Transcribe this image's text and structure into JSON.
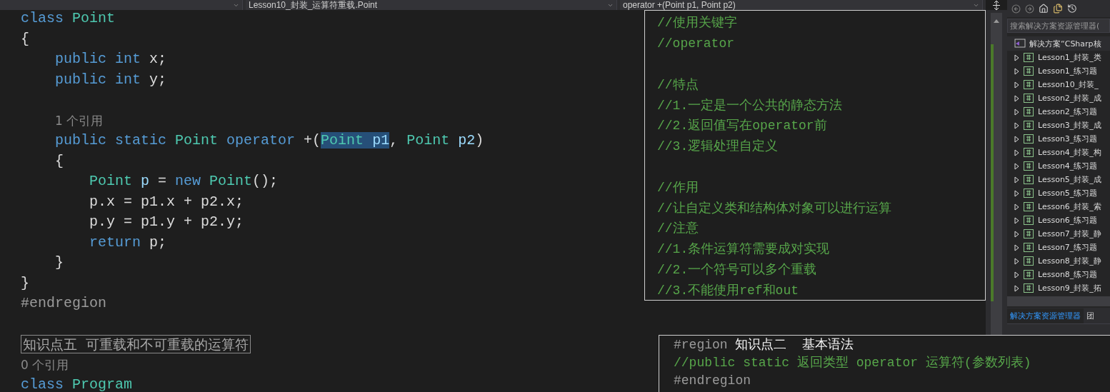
{
  "navbar": {
    "items": [
      {
        "label": "Lesson10_封装_运算符重载.Point",
        "kind": "class"
      },
      {
        "label": "operator +(Point p1, Point p2)",
        "kind": "member"
      }
    ]
  },
  "editor": {
    "lines": [
      {
        "kind": "code",
        "tokens": [
          {
            "text": "class ",
            "kind": "keyword"
          },
          {
            "text": "Point",
            "kind": "type"
          }
        ]
      },
      {
        "kind": "code",
        "tokens": [
          {
            "text": "{",
            "kind": "plain"
          }
        ]
      },
      {
        "kind": "code",
        "tokens": [
          {
            "text": "    public int",
            "kind": "keyword"
          },
          {
            "text": " x;",
            "kind": "plain"
          }
        ]
      },
      {
        "kind": "code",
        "tokens": [
          {
            "text": "    public int",
            "kind": "keyword"
          },
          {
            "text": " y;",
            "kind": "plain"
          }
        ]
      },
      {
        "kind": "blank"
      },
      {
        "kind": "codelens",
        "tokens": [
          {
            "text": "    1 个引用",
            "kind": "codelens"
          }
        ]
      },
      {
        "kind": "code",
        "tokens": [
          {
            "text": "    public static ",
            "kind": "keyword",
            "selected": false
          },
          {
            "text": "Point",
            "kind": "type",
            "selected": false
          },
          {
            "text": " operator",
            "kind": "keyword",
            "selected": false
          },
          {
            "text": " +(",
            "kind": "plain",
            "selected": false
          },
          {
            "text": "Point",
            "kind": "type",
            "selected": true
          },
          {
            "text": " p1",
            "kind": "param",
            "selected": true
          },
          {
            "text": ", ",
            "kind": "plain",
            "selected": false
          },
          {
            "text": "Point",
            "kind": "type",
            "selected": false
          },
          {
            "text": " p2",
            "kind": "param",
            "selected": false
          },
          {
            "text": ")",
            "kind": "plain",
            "selected": false
          }
        ]
      },
      {
        "kind": "code",
        "tokens": [
          {
            "text": "    {",
            "kind": "plain"
          }
        ]
      },
      {
        "kind": "code",
        "tokens": [
          {
            "text": "        Point",
            "kind": "type"
          },
          {
            "text": " p",
            "kind": "param"
          },
          {
            "text": " = ",
            "kind": "plain"
          },
          {
            "text": "new ",
            "kind": "keyword"
          },
          {
            "text": "Point",
            "kind": "type"
          },
          {
            "text": "();",
            "kind": "plain"
          }
        ]
      },
      {
        "kind": "code",
        "tokens": [
          {
            "text": "        p.x = p1.x + p2.x;",
            "kind": "plain"
          }
        ]
      },
      {
        "kind": "code",
        "tokens": [
          {
            "text": "        p.y = p1.y + p2.y;",
            "kind": "plain"
          }
        ]
      },
      {
        "kind": "code",
        "tokens": [
          {
            "text": "        return",
            "kind": "keyword"
          },
          {
            "text": " p;",
            "kind": "plain"
          }
        ]
      },
      {
        "kind": "code",
        "tokens": [
          {
            "text": "    }",
            "kind": "plain"
          }
        ]
      },
      {
        "kind": "code",
        "tokens": [
          {
            "text": "}",
            "kind": "plain"
          }
        ]
      },
      {
        "kind": "code",
        "tokens": [
          {
            "text": "#endregion",
            "kind": "directive"
          }
        ]
      },
      {
        "kind": "blank"
      },
      {
        "kind": "region",
        "tokens": [
          {
            "text": "知识点五  可重载和不可重载的运算符",
            "kind": "region"
          }
        ]
      },
      {
        "kind": "codelens",
        "tokens": [
          {
            "text": "0 个引用",
            "kind": "codelens"
          }
        ]
      },
      {
        "kind": "code",
        "tokens": [
          {
            "text": "class ",
            "kind": "keyword"
          },
          {
            "text": "Program",
            "kind": "type"
          }
        ]
      }
    ]
  },
  "peek_notes": {
    "lines": [
      {
        "kind": "code",
        "tokens": [
          {
            "text": "//使用关键字",
            "kind": "comment"
          }
        ]
      },
      {
        "kind": "code",
        "tokens": [
          {
            "text": "//operator",
            "kind": "comment"
          }
        ]
      },
      {
        "kind": "blank"
      },
      {
        "kind": "code",
        "tokens": [
          {
            "text": "//特点",
            "kind": "comment"
          }
        ]
      },
      {
        "kind": "code",
        "tokens": [
          {
            "text": "//1.一定是一个公共的静态方法",
            "kind": "comment"
          }
        ]
      },
      {
        "kind": "code",
        "tokens": [
          {
            "text": "//2.返回值写在operator前",
            "kind": "comment"
          }
        ]
      },
      {
        "kind": "code",
        "tokens": [
          {
            "text": "//3.逻辑处理自定义",
            "kind": "comment"
          }
        ]
      },
      {
        "kind": "blank"
      },
      {
        "kind": "code",
        "tokens": [
          {
            "text": "//作用",
            "kind": "comment"
          }
        ]
      },
      {
        "kind": "code",
        "tokens": [
          {
            "text": "//让自定义类和结构体对象可以进行运算",
            "kind": "comment"
          }
        ]
      },
      {
        "kind": "code",
        "tokens": [
          {
            "text": "//注意",
            "kind": "comment"
          }
        ]
      },
      {
        "kind": "code",
        "tokens": [
          {
            "text": "//1.条件运算符需要成对实现",
            "kind": "comment"
          }
        ]
      },
      {
        "kind": "code",
        "tokens": [
          {
            "text": "//2.一个符号可以多个重载",
            "kind": "comment"
          }
        ]
      },
      {
        "kind": "code",
        "tokens": [
          {
            "text": "//3.不能使用ref和out",
            "kind": "comment"
          }
        ]
      }
    ]
  },
  "peek_syntax": {
    "lines": [
      {
        "kind": "code",
        "tokens": [
          {
            "text": "#region ",
            "kind": "directive"
          },
          {
            "text": "知识点二  基本语法",
            "kind": "heading"
          }
        ]
      },
      {
        "kind": "code",
        "tokens": [
          {
            "text": "//public static 返回类型 operator 运算符(参数列表)",
            "kind": "comment"
          }
        ]
      },
      {
        "kind": "code",
        "tokens": [
          {
            "text": "#endregion",
            "kind": "directive"
          }
        ]
      }
    ]
  },
  "solution_explorer": {
    "search": {
      "placeholder": "搜索解决方案资源管理器("
    },
    "tree": [
      {
        "label": "解决方案“CSharp核",
        "kind": "solution",
        "children": [
          {
            "label": "Lesson1_封装_类",
            "kind": "project",
            "expanded": false
          },
          {
            "label": "Lesson1_练习题",
            "kind": "project",
            "expanded": false
          },
          {
            "label": "Lesson10_封装_",
            "kind": "project",
            "expanded": false
          },
          {
            "label": "Lesson2_封装_成",
            "kind": "project",
            "expanded": false
          },
          {
            "label": "Lesson2_练习题",
            "kind": "project",
            "expanded": false
          },
          {
            "label": "Lesson3_封装_成",
            "kind": "project",
            "expanded": false
          },
          {
            "label": "Lesson3_练习题",
            "kind": "project",
            "expanded": false
          },
          {
            "label": "Lesson4_封装_构",
            "kind": "project",
            "expanded": false
          },
          {
            "label": "Lesson4_练习题",
            "kind": "project",
            "expanded": false
          },
          {
            "label": "Lesson5_封装_成",
            "kind": "project",
            "expanded": false
          },
          {
            "label": "Lesson5_练习题",
            "kind": "project",
            "expanded": false
          },
          {
            "label": "Lesson6_封装_索",
            "kind": "project",
            "expanded": false
          },
          {
            "label": "Lesson6_练习题",
            "kind": "project",
            "expanded": false
          },
          {
            "label": "Lesson7_封装_静",
            "kind": "project",
            "expanded": false
          },
          {
            "label": "Lesson7_练习题",
            "kind": "project",
            "expanded": false
          },
          {
            "label": "Lesson8_封装_静",
            "kind": "project",
            "expanded": false
          },
          {
            "label": "Lesson8_练习题",
            "kind": "project",
            "expanded": false
          },
          {
            "label": "Lesson9_封装_拓",
            "kind": "project",
            "expanded": false
          }
        ]
      }
    ],
    "tabs": [
      {
        "label": "解决方案资源管理器",
        "selected": true
      },
      {
        "label": "团",
        "selected": false
      }
    ]
  }
}
